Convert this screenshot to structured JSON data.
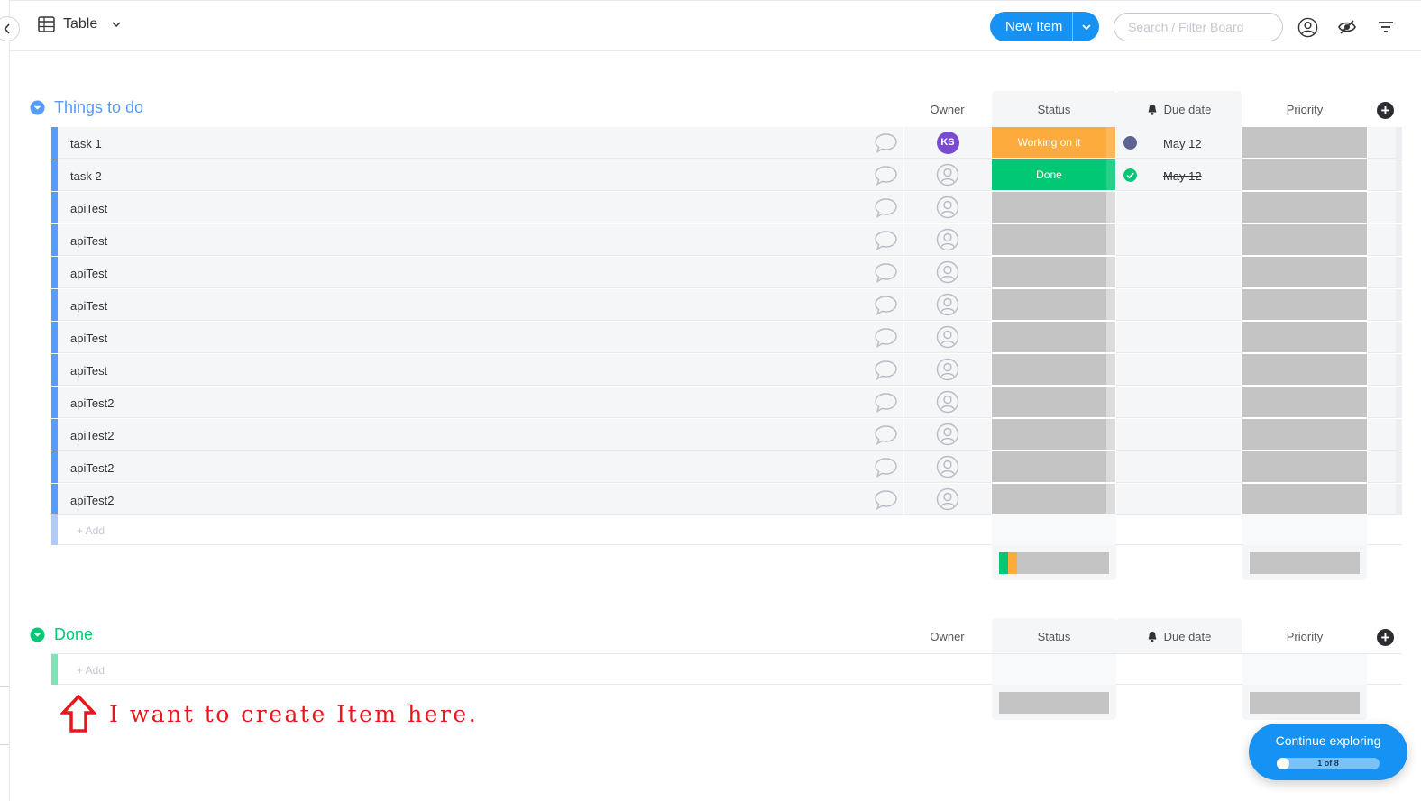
{
  "header": {
    "view_label": "Table",
    "new_item_label": "New Item",
    "search_placeholder": "Search / Filter Board"
  },
  "columns": {
    "owner": "Owner",
    "status": "Status",
    "due_date": "Due date",
    "priority": "Priority"
  },
  "groups": [
    {
      "title": "Things to do",
      "color": "#579bfc",
      "add_label": "+ Add",
      "rows": [
        {
          "name": "task 1",
          "owner": "KS",
          "owner_color": "#784bd1",
          "status": "Working on it",
          "status_color": "#fdab3d",
          "due": "May 12",
          "due_dot": "#5d6492",
          "due_done": false
        },
        {
          "name": "task 2",
          "owner": "",
          "status": "Done",
          "status_color": "#00c875",
          "due": "May 12",
          "due_dot": "#00c875",
          "due_done": true
        },
        {
          "name": "apiTest",
          "owner": "",
          "status": "",
          "due": ""
        },
        {
          "name": "apiTest",
          "owner": "",
          "status": "",
          "due": ""
        },
        {
          "name": "apiTest",
          "owner": "",
          "status": "",
          "due": ""
        },
        {
          "name": "apiTest",
          "owner": "",
          "status": "",
          "due": ""
        },
        {
          "name": "apiTest",
          "owner": "",
          "status": "",
          "due": ""
        },
        {
          "name": "apiTest",
          "owner": "",
          "status": "",
          "due": ""
        },
        {
          "name": "apiTest2",
          "owner": "",
          "status": "",
          "due": ""
        },
        {
          "name": "apiTest2",
          "owner": "",
          "status": "",
          "due": ""
        },
        {
          "name": "apiTest2",
          "owner": "",
          "status": "",
          "due": ""
        },
        {
          "name": "apiTest2",
          "owner": "",
          "status": "",
          "due": ""
        }
      ],
      "status_summary": [
        {
          "color": "#00c875",
          "fraction": 0.0833
        },
        {
          "color": "#fdab3d",
          "fraction": 0.0833
        }
      ]
    },
    {
      "title": "Done",
      "color": "#00c875",
      "add_label": "+ Add",
      "rows": [],
      "status_summary": []
    }
  ],
  "annotation": {
    "text": "I want to create Item here.",
    "color": "#e8161d"
  },
  "explore": {
    "label": "Continue exploring",
    "progress_text": "1 of 8",
    "progress_fraction": 0.125
  },
  "colors": {
    "brand_blue": "#1592f3",
    "empty_cell": "#c4c4c4"
  }
}
